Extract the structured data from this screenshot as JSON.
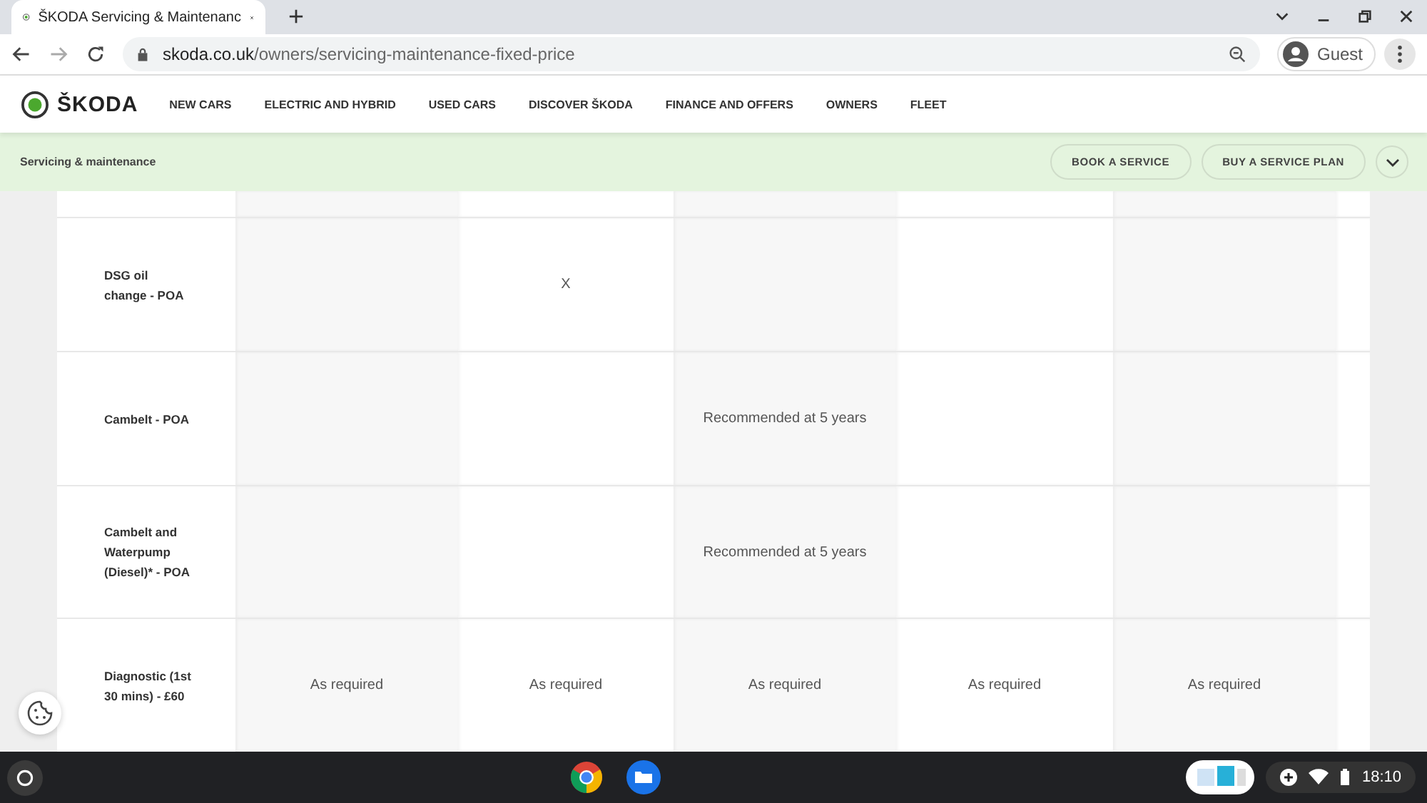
{
  "browser": {
    "tab": {
      "title": "ŠKODA Servicing & Maintenanc",
      "selected": true
    },
    "url_host": "skoda.co.uk",
    "url_path": "/owners/servicing-maintenance-fixed-price",
    "profile": "Guest"
  },
  "site": {
    "logo": "ŠKODA",
    "nav": [
      "NEW CARS",
      "ELECTRIC AND HYBRID",
      "USED CARS",
      "DISCOVER ŠKODA",
      "FINANCE AND OFFERS",
      "OWNERS",
      "FLEET"
    ]
  },
  "subbar": {
    "title": "Servicing & maintenance",
    "buttons": [
      "BOOK A SERVICE",
      "BUY A SERVICE PLAN"
    ]
  },
  "table": {
    "rows": [
      {
        "label": "DSG oil change - POA",
        "cells": [
          null,
          "X",
          null,
          null,
          null
        ]
      },
      {
        "label": "Cambelt - POA",
        "cells": [
          null,
          null,
          "Recommended at 5 years",
          null,
          null
        ]
      },
      {
        "label": "Cambelt and Waterpump (Diesel)* - POA",
        "cells": [
          null,
          null,
          "Recommended at 5 years",
          null,
          null
        ]
      },
      {
        "label": "Diagnostic (1st 30 mins) - £60",
        "cells": [
          "As required",
          "As required",
          "As required",
          "As required",
          "As required"
        ]
      }
    ]
  },
  "taskbar": {
    "time": "18:10"
  }
}
